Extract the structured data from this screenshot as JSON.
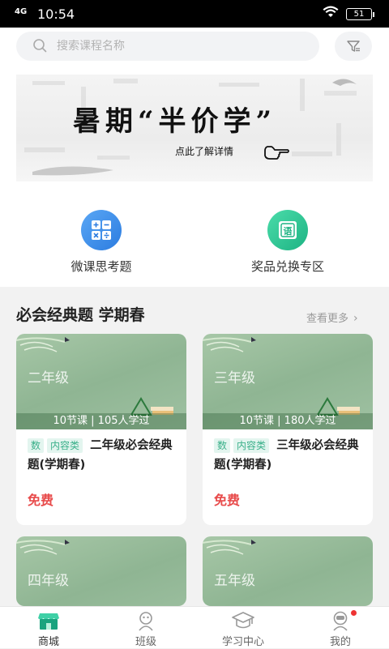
{
  "status_bar": {
    "signal": "4G",
    "time": "10:54",
    "battery": "51"
  },
  "search": {
    "placeholder": "搜索课程名称"
  },
  "banner": {
    "title": "暑期“半价学”",
    "subtitle": "点此了解详情"
  },
  "shortcuts": [
    {
      "label": "微课思考题",
      "icon": "calculator-icon",
      "color": "#3d8ee8"
    },
    {
      "label": "奖品兑换专区",
      "icon": "chinese-book-icon",
      "color": "#28c08e"
    }
  ],
  "section": {
    "title": "必会经典题 学期春",
    "see_more": "查看更多"
  },
  "cards": [
    {
      "grade": "二年级",
      "stats": "10节课 | 105人学过",
      "tags": [
        "数",
        "内容类"
      ],
      "title": "二年级必会经典题(学期春)",
      "price": "免费"
    },
    {
      "grade": "三年级",
      "stats": "10节课 | 180人学过",
      "tags": [
        "数",
        "内容类"
      ],
      "title": "三年级必会经典题(学期春)",
      "price": "免费"
    },
    {
      "grade": "四年级"
    },
    {
      "grade": "五年级"
    }
  ],
  "nav": [
    {
      "label": "商城",
      "icon": "store-icon",
      "active": true
    },
    {
      "label": "班级",
      "icon": "class-icon"
    },
    {
      "label": "学习中心",
      "icon": "graduation-cap-icon"
    },
    {
      "label": "我的",
      "icon": "profile-icon"
    }
  ],
  "colors": {
    "accent": "#28c08e",
    "price": "#e84b4b",
    "tag_bg": "#e3f5ef"
  }
}
